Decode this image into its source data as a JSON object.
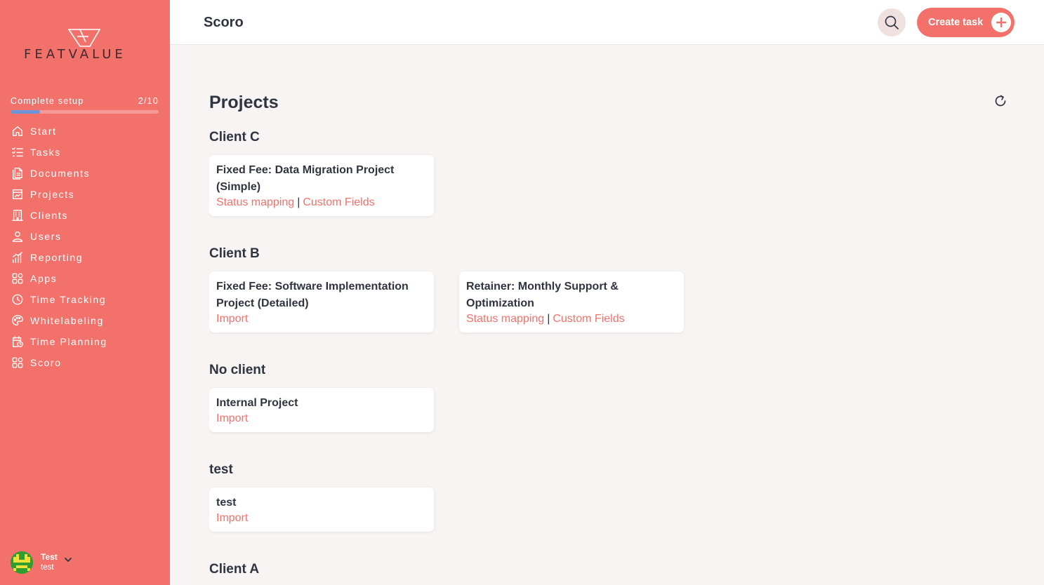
{
  "sidebar": {
    "logo_text": "FEATVALUE",
    "setup": {
      "label": "Complete setup",
      "progress_text": "2/10",
      "progress_fraction": 0.2
    },
    "nav": [
      {
        "label": "Start",
        "icon": "home-icon"
      },
      {
        "label": "Tasks",
        "icon": "task-list-icon"
      },
      {
        "label": "Documents",
        "icon": "documents-icon"
      },
      {
        "label": "Projects",
        "icon": "projects-icon"
      },
      {
        "label": "Clients",
        "icon": "building-icon"
      },
      {
        "label": "Users",
        "icon": "user-icon"
      },
      {
        "label": "Reporting",
        "icon": "bar-chart-icon"
      },
      {
        "label": "Apps",
        "icon": "apps-grid-icon"
      },
      {
        "label": "Time Tracking",
        "icon": "timer-icon"
      },
      {
        "label": "Whitelabeling",
        "icon": "palette-icon"
      },
      {
        "label": "Time Planning",
        "icon": "calendar-clock-icon"
      },
      {
        "label": "Scoro",
        "icon": "apps-grid-icon"
      }
    ],
    "user": {
      "name": "Test",
      "sub": "test"
    }
  },
  "topbar": {
    "title": "Scoro",
    "create_label": "Create task"
  },
  "main": {
    "title": "Projects",
    "groups": [
      {
        "title": "Client C",
        "cards": [
          {
            "title": "Fixed Fee: Data Migration Project (Simple)",
            "links": [
              "Status mapping",
              "Custom Fields"
            ]
          }
        ]
      },
      {
        "title": "Client B",
        "cards": [
          {
            "title": "Fixed Fee: Software Implementation Project (Detailed)",
            "links": [
              "Import"
            ]
          },
          {
            "title": "Retainer: Monthly Support & Optimization",
            "links": [
              "Status mapping",
              "Custom Fields"
            ]
          }
        ]
      },
      {
        "title": "No client",
        "cards": [
          {
            "title": "Internal Project",
            "links": [
              "Import"
            ]
          }
        ]
      },
      {
        "title": "test",
        "cards": [
          {
            "title": "test",
            "links": [
              "Import"
            ]
          }
        ]
      },
      {
        "title": "Client A",
        "cards": []
      }
    ]
  },
  "colors": {
    "accent": "#f2726b",
    "text": "#2f3440",
    "background": "#f7f4f3",
    "progress": "#6c95d9"
  }
}
